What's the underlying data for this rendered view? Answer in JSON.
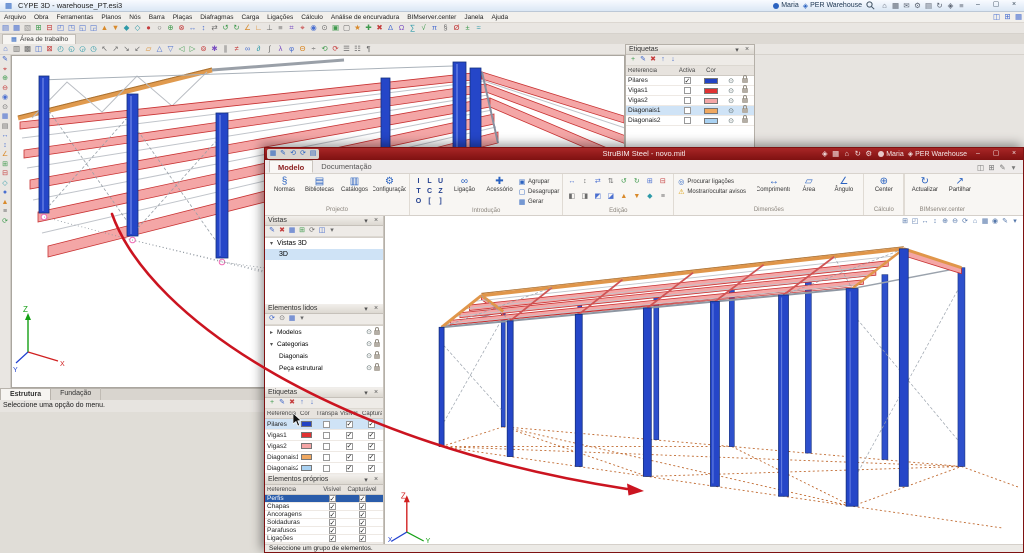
{
  "screen": {
    "user": "Maria",
    "project": "PER Warehouse",
    "win": {
      "min": "–",
      "max": "▢",
      "close": "×"
    }
  },
  "axes": {
    "z": "Z",
    "x": "X",
    "y": "Y"
  },
  "cype": {
    "window_title": "CYPE 3D - warehouse_PT.esi3",
    "menus": [
      "Arquivo",
      "Obra",
      "Ferramentas",
      "Planos",
      "Nós",
      "Barra",
      "Plaças",
      "Diafragmas",
      "Carga",
      "Ligações",
      "Cálculo",
      "Análise de encurvadura",
      "BIMserver.center",
      "Janela",
      "Ajuda"
    ],
    "workspace_tab": "Área de trabalho",
    "etiquetas": {
      "title": "Etiquetas",
      "columns": [
        "Referência",
        "Activa",
        "Cor"
      ],
      "rows": [
        {
          "ref": "Pilares",
          "active": true,
          "selected": false,
          "color": "#2343c3"
        },
        {
          "ref": "Vigas1",
          "active": false,
          "selected": false,
          "color": "#e03232"
        },
        {
          "ref": "Vigas2",
          "active": false,
          "selected": false,
          "color": "#f4a6a6"
        },
        {
          "ref": "Diagonais1",
          "active": false,
          "selected": true,
          "color": "#f0a860"
        },
        {
          "ref": "Diagonais2",
          "active": false,
          "selected": false,
          "color": "#aad2f2"
        }
      ]
    },
    "bottom_tabs": [
      "Estrutura",
      "Fundação"
    ],
    "status": "Seleccione uma opção do menu."
  },
  "strubim": {
    "window_title": "StruBIM Steel - novo.mitl",
    "tabs": [
      "Modelo",
      "Documentação"
    ],
    "ribbon": {
      "projecto": {
        "label": "Projecto",
        "items": [
          "Normas",
          "Bibliotecas",
          "Catálogos",
          "Configuração"
        ],
        "icons": [
          "§",
          "▤",
          "▥",
          "⚙"
        ]
      },
      "introducao": {
        "label": "Introdução",
        "big": [
          "Ligação",
          "Acessório"
        ],
        "big_icons": [
          "∞",
          "✚"
        ],
        "stack": [
          "Agrupar",
          "Desagrupar",
          "Gerar"
        ],
        "stack_icons": [
          "▣",
          "▢",
          "▦"
        ]
      },
      "edicao": {
        "label": "Edição"
      },
      "dimensoes": {
        "label": "Dimensões",
        "stack": [
          "Procurar ligações",
          "Mostrar/ocultar avisos"
        ],
        "stack_icons": [
          "◎",
          "⚠"
        ],
        "items": [
          "Comprimento",
          "Área",
          "Ângulo"
        ],
        "icons": [
          "↔",
          "▱",
          "∠"
        ]
      },
      "calculo": {
        "label": "Cálculo",
        "items": [
          "Center"
        ],
        "icons": [
          "⊕"
        ]
      },
      "bimserver": {
        "label": "BIMserver.center",
        "items": [
          "Actualizar",
          "Partilhar"
        ],
        "icons": [
          "↻",
          "↗"
        ]
      }
    },
    "vistas": {
      "title": "Vistas",
      "root": "Vistas 3D",
      "child": "3D",
      "child_selected": true
    },
    "elementos_lidos": {
      "title": "Elementos lidos",
      "rows": [
        "Modelos",
        "Categorias",
        "Diagonais",
        "Peça estrutural"
      ]
    },
    "etiquetas": {
      "title": "Etiquetas",
      "columns": [
        "Referência",
        "Cor",
        "Transparente",
        "Visível",
        "Capturável"
      ],
      "rows": [
        {
          "ref": "Pilares",
          "color": "#2343c3",
          "transparente": false,
          "visivel": true,
          "capturavel": true,
          "selected": true
        },
        {
          "ref": "Vigas1",
          "color": "#e03232",
          "transparente": false,
          "visivel": true,
          "capturavel": true,
          "selected": false
        },
        {
          "ref": "Vigas2",
          "color": "#f4a6a6",
          "transparente": false,
          "visivel": true,
          "capturavel": true,
          "selected": false
        },
        {
          "ref": "Diagonais1",
          "color": "#f0a860",
          "transparente": false,
          "visivel": true,
          "capturavel": true,
          "selected": false
        },
        {
          "ref": "Diagonais2",
          "color": "#aad2f2",
          "transparente": false,
          "visivel": true,
          "capturavel": true,
          "selected": false
        }
      ]
    },
    "elementos_proprios": {
      "title": "Elementos próprios",
      "columns": [
        "Referência",
        "Visível",
        "Capturável"
      ],
      "rows": [
        {
          "ref": "Perfis",
          "visivel": true,
          "capturavel": true,
          "selected": true
        },
        {
          "ref": "Chapas",
          "visivel": true,
          "capturavel": true,
          "selected": false
        },
        {
          "ref": "Ancoragens",
          "visivel": true,
          "capturavel": true,
          "selected": false
        },
        {
          "ref": "Soldaduras",
          "visivel": true,
          "capturavel": true,
          "selected": false
        },
        {
          "ref": "Parafusos",
          "visivel": true,
          "capturavel": true,
          "selected": false
        },
        {
          "ref": "Ligações",
          "visivel": true,
          "capturavel": true,
          "selected": false
        }
      ]
    },
    "status": "Seleccione um grupo de elementos."
  },
  "icons": {
    "cype_title": [
      [
        "⌂",
        "#5a6270"
      ],
      [
        "▦",
        "#5a6270"
      ],
      [
        "✉",
        "#5a6270"
      ],
      [
        "⚙",
        "#5a6270"
      ],
      [
        "▤",
        "#5a6270"
      ],
      [
        "↻",
        "#5a6270"
      ],
      [
        "◈",
        "#5a6270"
      ],
      [
        "≡",
        "#5a6270"
      ]
    ],
    "cype_t1": [
      [
        "▤",
        "#4a6fd0"
      ],
      [
        "▦",
        "#4a6fd0"
      ],
      [
        "▧",
        "#8a8a8a"
      ],
      [
        "⊞",
        "#3f9a4d"
      ],
      [
        "⊟",
        "#c43b3b"
      ],
      [
        "◰",
        "#4a6fd0"
      ],
      [
        "◳",
        "#4a6fd0"
      ],
      [
        "◱",
        "#4a6fd0"
      ],
      [
        "◲",
        "#4a6fd0"
      ],
      [
        "▲",
        "#d98a2b"
      ],
      [
        "▼",
        "#d98a2b"
      ],
      [
        "◆",
        "#2e9aa8"
      ],
      [
        "◇",
        "#2e9aa8"
      ],
      [
        "●",
        "#c43b3b"
      ],
      [
        "○",
        "#6b6b6b"
      ],
      [
        "⊕",
        "#3f9a4d"
      ],
      [
        "⊗",
        "#c43b3b"
      ],
      [
        "↔",
        "#4a6fd0"
      ],
      [
        "↕",
        "#4a6fd0"
      ],
      [
        "⇄",
        "#6b6b6b"
      ],
      [
        "↺",
        "#3f9a4d"
      ],
      [
        "↻",
        "#3f9a4d"
      ],
      [
        "∠",
        "#d98a2b"
      ],
      [
        "∟",
        "#d98a2b"
      ],
      [
        "⊥",
        "#6b6b6b"
      ],
      [
        "≡",
        "#6b6b6b"
      ],
      [
        "⌗",
        "#7a4fc0"
      ],
      [
        "⌖",
        "#c43b3b"
      ],
      [
        "◉",
        "#4a6fd0"
      ],
      [
        "⊙",
        "#6b6b6b"
      ],
      [
        "▣",
        "#3f9a4d"
      ],
      [
        "▢",
        "#6b6b6b"
      ],
      [
        "★",
        "#d98a2b"
      ],
      [
        "✚",
        "#3f9a4d"
      ],
      [
        "✖",
        "#c43b3b"
      ],
      [
        "Δ",
        "#4a6fd0"
      ],
      [
        "Ω",
        "#7a4fc0"
      ],
      [
        "∑",
        "#2e9aa8"
      ],
      [
        "√",
        "#3f9a4d"
      ],
      [
        "π",
        "#4a6fd0"
      ],
      [
        "§",
        "#6b6b6b"
      ],
      [
        "Ø",
        "#c43b3b"
      ],
      [
        "±",
        "#3f9a4d"
      ],
      [
        "≈",
        "#2e9aa8"
      ]
    ],
    "cype_t2": [
      [
        "⌂",
        "#4a6fd0"
      ],
      [
        "▥",
        "#6b6b6b"
      ],
      [
        "▩",
        "#6b6b6b"
      ],
      [
        "◫",
        "#4a6fd0"
      ],
      [
        "⊠",
        "#c43b3b"
      ],
      [
        "◴",
        "#2e9aa8"
      ],
      [
        "◵",
        "#2e9aa8"
      ],
      [
        "◶",
        "#2e9aa8"
      ],
      [
        "◷",
        "#2e9aa8"
      ],
      [
        "↖",
        "#6b6b6b"
      ],
      [
        "↗",
        "#6b6b6b"
      ],
      [
        "↘",
        "#6b6b6b"
      ],
      [
        "↙",
        "#6b6b6b"
      ],
      [
        "▱",
        "#d98a2b"
      ],
      [
        "△",
        "#4a6fd0"
      ],
      [
        "▽",
        "#4a6fd0"
      ],
      [
        "◁",
        "#3f9a4d"
      ],
      [
        "▷",
        "#3f9a4d"
      ],
      [
        "⊚",
        "#c43b3b"
      ],
      [
        "✱",
        "#7a4fc0"
      ],
      [
        "∥",
        "#6b6b6b"
      ],
      [
        "≠",
        "#c43b3b"
      ],
      [
        "∞",
        "#4a6fd0"
      ],
      [
        "∂",
        "#2e9aa8"
      ],
      [
        "∫",
        "#6b6b6b"
      ],
      [
        "λ",
        "#7a4fc0"
      ],
      [
        "φ",
        "#4a6fd0"
      ],
      [
        "Θ",
        "#d98a2b"
      ],
      [
        "÷",
        "#6b6b6b"
      ],
      [
        "⟲",
        "#3f9a4d"
      ],
      [
        "⟳",
        "#c43b3b"
      ],
      [
        "☰",
        "#6b6b6b"
      ],
      [
        "☷",
        "#6b6b6b"
      ],
      [
        "¶",
        "#6b6b6b"
      ]
    ],
    "cype_left": [
      [
        "✎",
        "#3a62c8"
      ],
      [
        "⌖",
        "#c43b3b"
      ],
      [
        "⊕",
        "#3f9a4d"
      ],
      [
        "⊖",
        "#c43b3b"
      ],
      [
        "◉",
        "#4a6fd0"
      ],
      [
        "⊙",
        "#6b6b6b"
      ],
      [
        "▦",
        "#4a6fd0"
      ],
      [
        "▤",
        "#6b6b6b"
      ],
      [
        "↔",
        "#4a6fd0"
      ],
      [
        "↕",
        "#4a6fd0"
      ],
      [
        "∠",
        "#d98a2b"
      ],
      [
        "⊞",
        "#3f9a4d"
      ],
      [
        "⊟",
        "#c43b3b"
      ],
      [
        "◇",
        "#2e9aa8"
      ],
      [
        "●",
        "#4a6fd0"
      ],
      [
        "▲",
        "#d98a2b"
      ],
      [
        "≡",
        "#6b6b6b"
      ],
      [
        "⟳",
        "#3f9a4d"
      ]
    ],
    "cype_etq_tb": [
      [
        "+",
        "#3f9a4d"
      ],
      [
        "✎",
        "#3a62c8"
      ],
      [
        "✖",
        "#c43b3b"
      ],
      [
        "↑",
        "#3a62c8"
      ],
      [
        "↓",
        "#3a62c8"
      ]
    ],
    "menu_right": [
      [
        "◫",
        "#4a6fd0"
      ],
      [
        "⊞",
        "#4a6fd0"
      ],
      [
        "▦",
        "#4a6fd0"
      ]
    ],
    "sb_qat": [
      [
        "▦",
        "#2a62c0"
      ],
      [
        "✎",
        "#2a62c0"
      ],
      [
        "⟲",
        "#2a62c0"
      ],
      [
        "⟳",
        "#2a62c0"
      ],
      [
        "▤",
        "#2a62c0"
      ]
    ],
    "sb_title_right": [
      [
        "◈",
        "#f0dcdc"
      ],
      [
        "▦",
        "#f0dcdc"
      ],
      [
        "⌂",
        "#f0dcdc"
      ],
      [
        "↻",
        "#f0dcdc"
      ],
      [
        "⚙",
        "#f0dcdc"
      ]
    ],
    "sb_tab_right": [
      [
        "◫",
        "#777777"
      ],
      [
        "⊞",
        "#777777"
      ],
      [
        "✎",
        "#777777"
      ],
      [
        "▾",
        "#777777"
      ]
    ],
    "sb_view": [
      [
        "⊞",
        "#5577aa"
      ],
      [
        "◰",
        "#5577aa"
      ],
      [
        "↔",
        "#5577aa"
      ],
      [
        "↕",
        "#5577aa"
      ],
      [
        "⊕",
        "#5577aa"
      ],
      [
        "⊖",
        "#5577aa"
      ],
      [
        "⟳",
        "#5577aa"
      ],
      [
        "⌂",
        "#5577aa"
      ],
      [
        "▦",
        "#5577aa"
      ],
      [
        "◉",
        "#5577aa"
      ],
      [
        "✎",
        "#5577aa"
      ],
      [
        "▾",
        "#5577aa"
      ]
    ],
    "sb_vistas_tb": [
      [
        "✎",
        "#3a62c8"
      ],
      [
        "✖",
        "#c43b3b"
      ],
      [
        "▦",
        "#3a62c8"
      ],
      [
        "⊞",
        "#3f9a4d"
      ],
      [
        "⟳",
        "#6b6b6b"
      ],
      [
        "◫",
        "#3a62c8"
      ],
      [
        "▾",
        "#6b6b6b"
      ]
    ],
    "sb_lidos_tb": [
      [
        "⟳",
        "#3a62c8"
      ],
      [
        "⊙",
        "#6b6b6b"
      ],
      [
        "▦",
        "#3a62c8"
      ],
      [
        "▾",
        "#6b6b6b"
      ]
    ],
    "sb_etq_tb": [
      [
        "+",
        "#3f9a4d"
      ],
      [
        "✎",
        "#3a62c8"
      ],
      [
        "✖",
        "#c43b3b"
      ],
      [
        "↑",
        "#3a62c8"
      ],
      [
        "↓",
        "#3a62c8"
      ]
    ],
    "intro_grid": [
      [
        "I",
        "#23408f"
      ],
      [
        "L",
        "#23408f"
      ],
      [
        "U",
        "#23408f"
      ],
      [
        "T",
        "#23408f"
      ],
      [
        "C",
        "#23408f"
      ],
      [
        "Z",
        "#23408f"
      ],
      [
        "O",
        "#23408f"
      ],
      [
        "[",
        "#23408f"
      ],
      [
        "]",
        "#23408f"
      ]
    ],
    "edicao_grid": [
      [
        "↔",
        "#4a6fd0"
      ],
      [
        "↕",
        "#6b6b6b"
      ],
      [
        "⇄",
        "#4a6fd0"
      ],
      [
        "⇅",
        "#6b6b6b"
      ],
      [
        "↺",
        "#3f9a4d"
      ],
      [
        "↻",
        "#3f9a4d"
      ],
      [
        "⊞",
        "#4a6fd0"
      ],
      [
        "⊟",
        "#c43b3b"
      ],
      [
        "◧",
        "#6b6b6b"
      ],
      [
        "◨",
        "#6b6b6b"
      ],
      [
        "◩",
        "#4a6fd0"
      ],
      [
        "◪",
        "#4a6fd0"
      ],
      [
        "▲",
        "#d98a2b"
      ],
      [
        "▼",
        "#d98a2b"
      ],
      [
        "◆",
        "#2e9aa8"
      ],
      [
        "≡",
        "#6b6b6b"
      ]
    ]
  }
}
